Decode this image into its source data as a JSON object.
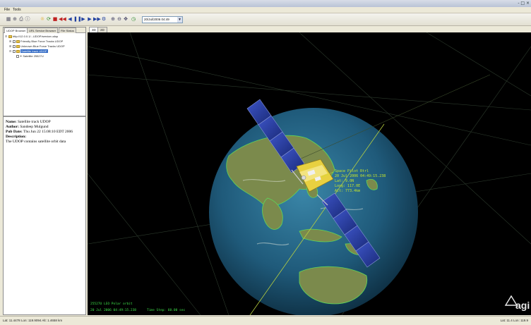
{
  "window": {
    "close_glyph": "- □ ×"
  },
  "menu": {
    "items": [
      "File",
      "Tools"
    ]
  },
  "toolbar": {
    "date_value": "20/Jul/2006 04:49",
    "buttons": [
      "grid-icon",
      "zoom-icon",
      "print-icon",
      "info-icon",
      "sun-icon",
      "refresh-icon",
      "stop-icon",
      "rewind-icon",
      "step-back-icon",
      "pause-icon",
      "play-icon",
      "step-forward-icon",
      "fast-forward-icon",
      "settings-icon",
      "zoom-in-icon",
      "zoom-out-icon",
      "pan-icon",
      "time-icon"
    ]
  },
  "left_panel": {
    "tabs": [
      "UDOP Browser",
      "URL Service Browser",
      "File Status"
    ],
    "tree": [
      {
        "label": "http://12.0.0.1/...UDOP/service.udop",
        "level": 0,
        "type": "folder"
      },
      {
        "label": "Friendly Blue Force Tracks UDOP",
        "level": 1,
        "type": "check"
      },
      {
        "label": "Unknown Blue Force Tracks UDOP",
        "level": 1,
        "type": "check"
      },
      {
        "label": "Satellite track UDOP",
        "level": 1,
        "type": "check",
        "selected": true
      },
      {
        "label": "Satellite 25527U",
        "level": 2,
        "type": "sat"
      }
    ],
    "description": {
      "name_label": "Name:",
      "name_value": "Satellite track UDOP",
      "author_label": "Author:",
      "author_value": "Sandeep Mulgund",
      "pubdate_label": "Pub Date:",
      "pubdate_value": "Thu Jun 22 15:08:10 EDT 2006",
      "description_label": "Description:",
      "description_value": "The UDOP contains satellite orbit data"
    }
  },
  "view": {
    "tabs": [
      "3D",
      "2D"
    ],
    "hud_lines": [
      "Space Pilot Rtrl",
      "20 Jul 2006 04:49:15.238",
      "Lat:  9.0N",
      "Long: 117.0E",
      "Alt:  773.4km"
    ],
    "bottom_hud": [
      "25527U LEO Polar orbit",
      "20 Jul 2006 04:49:15.238",
      "Time Step: 60.00 sec"
    ]
  },
  "logo": {
    "text": "agi"
  },
  "status": {
    "left": "Lat: 11.4478 Lon: 119.9094  Alt: 1.4658 km",
    "right": "Lat: 11.4 Lon: 119.9"
  },
  "colors": {
    "hud": "#c8e62a",
    "hud_secondary": "#3ee04a",
    "ocean": "#1f5a7a",
    "land": "#7a8a4a",
    "panel": "#2a3a8c"
  }
}
